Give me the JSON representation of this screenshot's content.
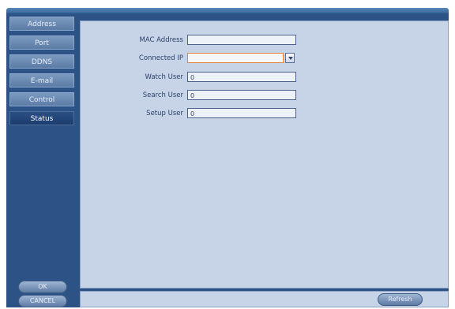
{
  "sidebar": {
    "items": [
      {
        "label": "Address",
        "active": false
      },
      {
        "label": "Port",
        "active": false
      },
      {
        "label": "DDNS",
        "active": false
      },
      {
        "label": "E-mail",
        "active": false
      },
      {
        "label": "Control",
        "active": false
      },
      {
        "label": "Status",
        "active": true
      }
    ]
  },
  "form": {
    "mac_label": "MAC Address",
    "mac_value": "",
    "ip_label": "Connected IP",
    "ip_value": "",
    "watch_label": "Watch User",
    "watch_value": "0",
    "search_label": "Search User",
    "search_value": "0",
    "setup_label": "Setup User",
    "setup_value": "0"
  },
  "buttons": {
    "ok": "OK",
    "cancel": "CANCEL",
    "refresh": "Refresh"
  },
  "colors": {
    "panel": "#2c5286",
    "content": "#c7d4e8",
    "highlight_border": "#e6813a"
  }
}
